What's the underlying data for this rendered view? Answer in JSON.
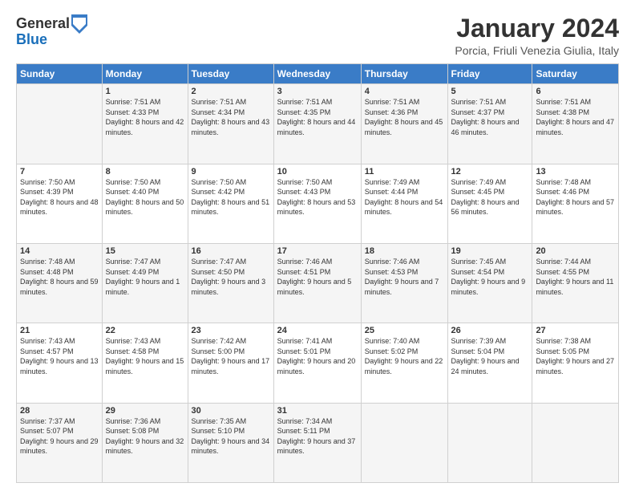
{
  "header": {
    "logo_general": "General",
    "logo_blue": "Blue",
    "month_title": "January 2024",
    "location": "Porcia, Friuli Venezia Giulia, Italy"
  },
  "days_of_week": [
    "Sunday",
    "Monday",
    "Tuesday",
    "Wednesday",
    "Thursday",
    "Friday",
    "Saturday"
  ],
  "weeks": [
    [
      {
        "day": "",
        "sunrise": "",
        "sunset": "",
        "daylight": ""
      },
      {
        "day": "1",
        "sunrise": "Sunrise: 7:51 AM",
        "sunset": "Sunset: 4:33 PM",
        "daylight": "Daylight: 8 hours and 42 minutes."
      },
      {
        "day": "2",
        "sunrise": "Sunrise: 7:51 AM",
        "sunset": "Sunset: 4:34 PM",
        "daylight": "Daylight: 8 hours and 43 minutes."
      },
      {
        "day": "3",
        "sunrise": "Sunrise: 7:51 AM",
        "sunset": "Sunset: 4:35 PM",
        "daylight": "Daylight: 8 hours and 44 minutes."
      },
      {
        "day": "4",
        "sunrise": "Sunrise: 7:51 AM",
        "sunset": "Sunset: 4:36 PM",
        "daylight": "Daylight: 8 hours and 45 minutes."
      },
      {
        "day": "5",
        "sunrise": "Sunrise: 7:51 AM",
        "sunset": "Sunset: 4:37 PM",
        "daylight": "Daylight: 8 hours and 46 minutes."
      },
      {
        "day": "6",
        "sunrise": "Sunrise: 7:51 AM",
        "sunset": "Sunset: 4:38 PM",
        "daylight": "Daylight: 8 hours and 47 minutes."
      }
    ],
    [
      {
        "day": "7",
        "sunrise": "Sunrise: 7:50 AM",
        "sunset": "Sunset: 4:39 PM",
        "daylight": "Daylight: 8 hours and 48 minutes."
      },
      {
        "day": "8",
        "sunrise": "Sunrise: 7:50 AM",
        "sunset": "Sunset: 4:40 PM",
        "daylight": "Daylight: 8 hours and 50 minutes."
      },
      {
        "day": "9",
        "sunrise": "Sunrise: 7:50 AM",
        "sunset": "Sunset: 4:42 PM",
        "daylight": "Daylight: 8 hours and 51 minutes."
      },
      {
        "day": "10",
        "sunrise": "Sunrise: 7:50 AM",
        "sunset": "Sunset: 4:43 PM",
        "daylight": "Daylight: 8 hours and 53 minutes."
      },
      {
        "day": "11",
        "sunrise": "Sunrise: 7:49 AM",
        "sunset": "Sunset: 4:44 PM",
        "daylight": "Daylight: 8 hours and 54 minutes."
      },
      {
        "day": "12",
        "sunrise": "Sunrise: 7:49 AM",
        "sunset": "Sunset: 4:45 PM",
        "daylight": "Daylight: 8 hours and 56 minutes."
      },
      {
        "day": "13",
        "sunrise": "Sunrise: 7:48 AM",
        "sunset": "Sunset: 4:46 PM",
        "daylight": "Daylight: 8 hours and 57 minutes."
      }
    ],
    [
      {
        "day": "14",
        "sunrise": "Sunrise: 7:48 AM",
        "sunset": "Sunset: 4:48 PM",
        "daylight": "Daylight: 8 hours and 59 minutes."
      },
      {
        "day": "15",
        "sunrise": "Sunrise: 7:47 AM",
        "sunset": "Sunset: 4:49 PM",
        "daylight": "Daylight: 9 hours and 1 minute."
      },
      {
        "day": "16",
        "sunrise": "Sunrise: 7:47 AM",
        "sunset": "Sunset: 4:50 PM",
        "daylight": "Daylight: 9 hours and 3 minutes."
      },
      {
        "day": "17",
        "sunrise": "Sunrise: 7:46 AM",
        "sunset": "Sunset: 4:51 PM",
        "daylight": "Daylight: 9 hours and 5 minutes."
      },
      {
        "day": "18",
        "sunrise": "Sunrise: 7:46 AM",
        "sunset": "Sunset: 4:53 PM",
        "daylight": "Daylight: 9 hours and 7 minutes."
      },
      {
        "day": "19",
        "sunrise": "Sunrise: 7:45 AM",
        "sunset": "Sunset: 4:54 PM",
        "daylight": "Daylight: 9 hours and 9 minutes."
      },
      {
        "day": "20",
        "sunrise": "Sunrise: 7:44 AM",
        "sunset": "Sunset: 4:55 PM",
        "daylight": "Daylight: 9 hours and 11 minutes."
      }
    ],
    [
      {
        "day": "21",
        "sunrise": "Sunrise: 7:43 AM",
        "sunset": "Sunset: 4:57 PM",
        "daylight": "Daylight: 9 hours and 13 minutes."
      },
      {
        "day": "22",
        "sunrise": "Sunrise: 7:43 AM",
        "sunset": "Sunset: 4:58 PM",
        "daylight": "Daylight: 9 hours and 15 minutes."
      },
      {
        "day": "23",
        "sunrise": "Sunrise: 7:42 AM",
        "sunset": "Sunset: 5:00 PM",
        "daylight": "Daylight: 9 hours and 17 minutes."
      },
      {
        "day": "24",
        "sunrise": "Sunrise: 7:41 AM",
        "sunset": "Sunset: 5:01 PM",
        "daylight": "Daylight: 9 hours and 20 minutes."
      },
      {
        "day": "25",
        "sunrise": "Sunrise: 7:40 AM",
        "sunset": "Sunset: 5:02 PM",
        "daylight": "Daylight: 9 hours and 22 minutes."
      },
      {
        "day": "26",
        "sunrise": "Sunrise: 7:39 AM",
        "sunset": "Sunset: 5:04 PM",
        "daylight": "Daylight: 9 hours and 24 minutes."
      },
      {
        "day": "27",
        "sunrise": "Sunrise: 7:38 AM",
        "sunset": "Sunset: 5:05 PM",
        "daylight": "Daylight: 9 hours and 27 minutes."
      }
    ],
    [
      {
        "day": "28",
        "sunrise": "Sunrise: 7:37 AM",
        "sunset": "Sunset: 5:07 PM",
        "daylight": "Daylight: 9 hours and 29 minutes."
      },
      {
        "day": "29",
        "sunrise": "Sunrise: 7:36 AM",
        "sunset": "Sunset: 5:08 PM",
        "daylight": "Daylight: 9 hours and 32 minutes."
      },
      {
        "day": "30",
        "sunrise": "Sunrise: 7:35 AM",
        "sunset": "Sunset: 5:10 PM",
        "daylight": "Daylight: 9 hours and 34 minutes."
      },
      {
        "day": "31",
        "sunrise": "Sunrise: 7:34 AM",
        "sunset": "Sunset: 5:11 PM",
        "daylight": "Daylight: 9 hours and 37 minutes."
      },
      {
        "day": "",
        "sunrise": "",
        "sunset": "",
        "daylight": ""
      },
      {
        "day": "",
        "sunrise": "",
        "sunset": "",
        "daylight": ""
      },
      {
        "day": "",
        "sunrise": "",
        "sunset": "",
        "daylight": ""
      }
    ]
  ]
}
